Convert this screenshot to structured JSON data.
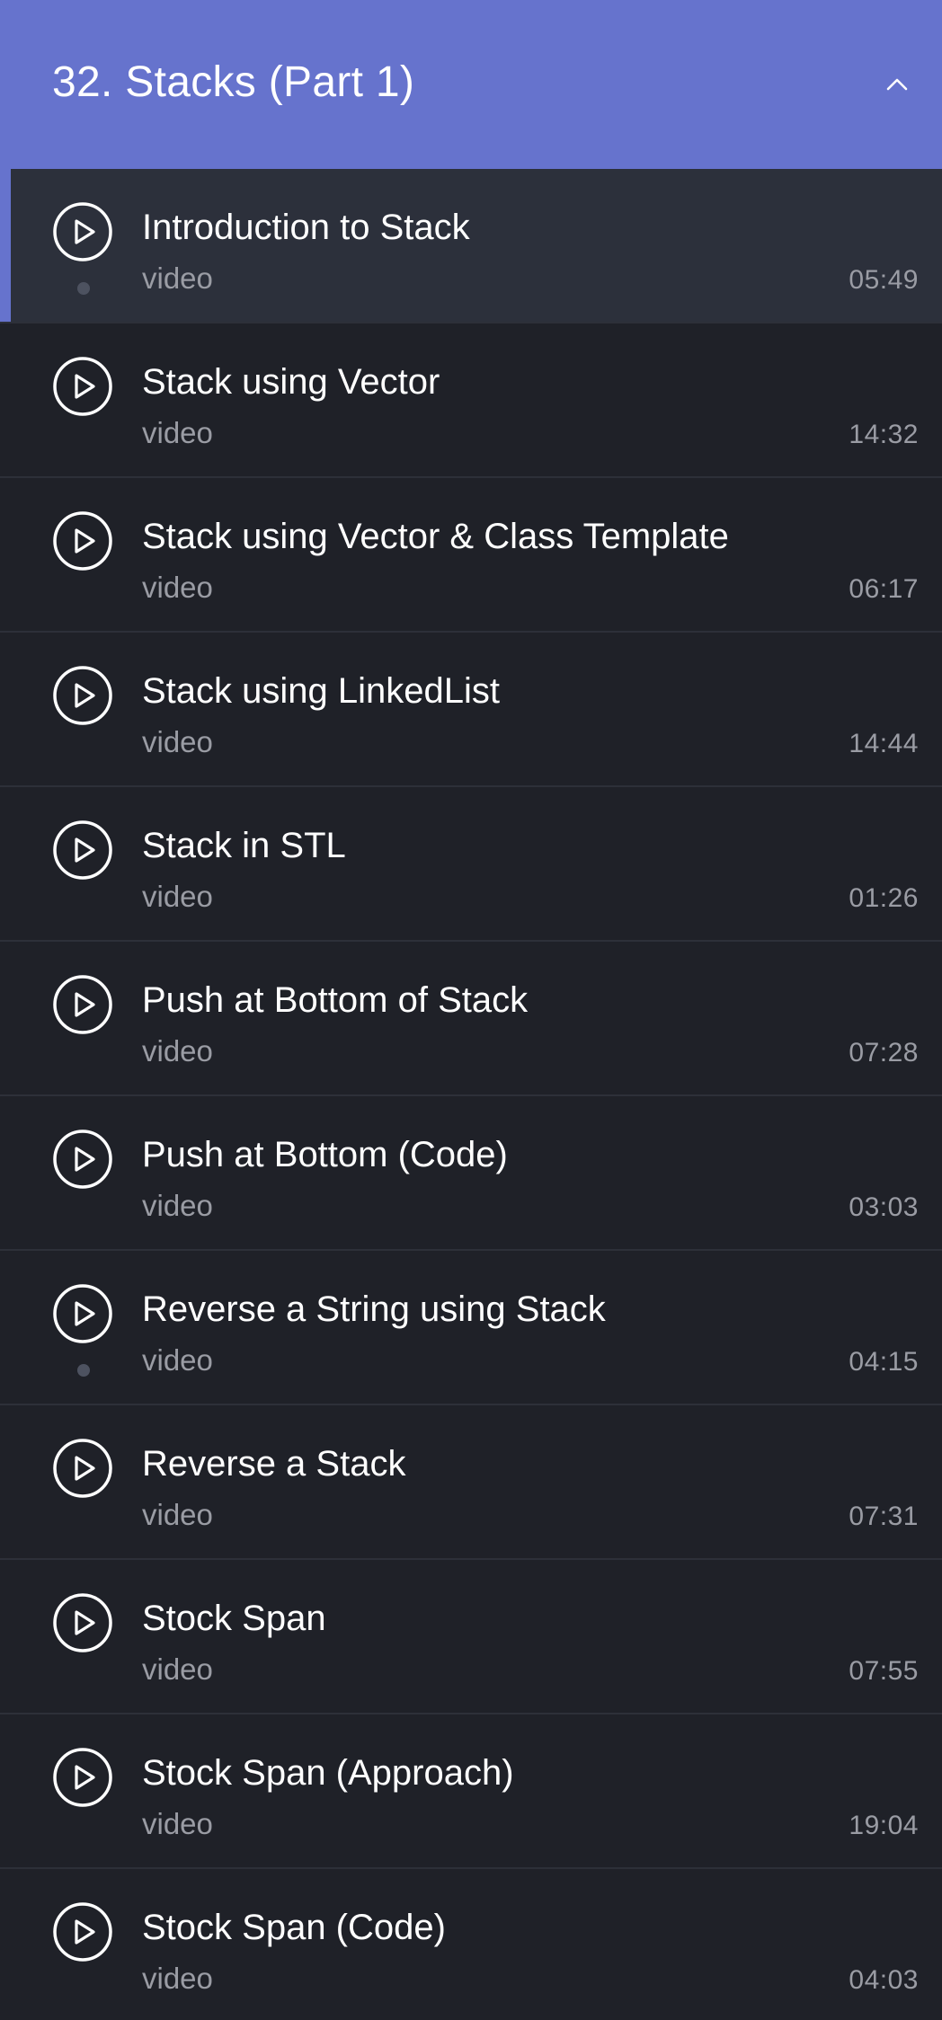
{
  "section": {
    "title": "32. Stacks (Part 1)",
    "expanded": true,
    "header_color": "#6673cd"
  },
  "lessons": [
    {
      "title": "Introduction to Stack",
      "type": "video",
      "duration": "05:49",
      "active": true,
      "dot": true
    },
    {
      "title": "Stack using Vector",
      "type": "video",
      "duration": "14:32",
      "active": false,
      "dot": false
    },
    {
      "title": "Stack using Vector & Class Template",
      "type": "video",
      "duration": "06:17",
      "active": false,
      "dot": false
    },
    {
      "title": "Stack using LinkedList",
      "type": "video",
      "duration": "14:44",
      "active": false,
      "dot": false
    },
    {
      "title": "Stack in STL",
      "type": "video",
      "duration": "01:26",
      "active": false,
      "dot": false
    },
    {
      "title": "Push at Bottom of Stack",
      "type": "video",
      "duration": "07:28",
      "active": false,
      "dot": false
    },
    {
      "title": "Push at Bottom (Code)",
      "type": "video",
      "duration": "03:03",
      "active": false,
      "dot": false
    },
    {
      "title": "Reverse a String using Stack",
      "type": "video",
      "duration": "04:15",
      "active": false,
      "dot": true
    },
    {
      "title": "Reverse a Stack",
      "type": "video",
      "duration": "07:31",
      "active": false,
      "dot": false
    },
    {
      "title": "Stock Span",
      "type": "video",
      "duration": "07:55",
      "active": false,
      "dot": false
    },
    {
      "title": "Stock Span (Approach)",
      "type": "video",
      "duration": "19:04",
      "active": false,
      "dot": false
    },
    {
      "title": "Stock Span (Code)",
      "type": "video",
      "duration": "04:03",
      "active": false,
      "dot": false
    }
  ],
  "icons": {
    "play": "play-circle-icon",
    "collapse": "chevron-up-icon"
  }
}
